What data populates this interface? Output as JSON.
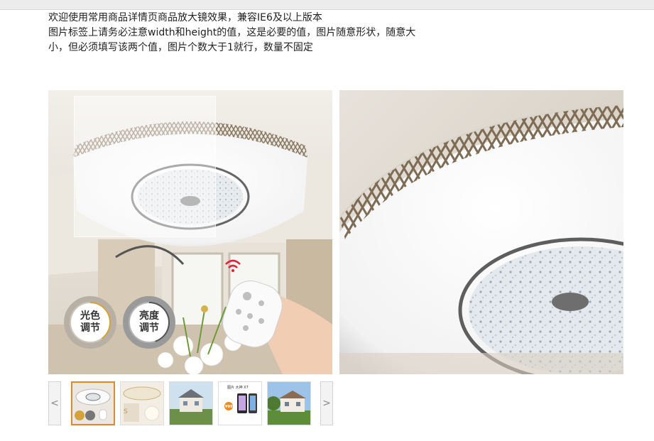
{
  "intro": {
    "line1": "欢迎使用常用商品详情页商品放大镜效果，兼容IE6及以上版本",
    "line2": "图片标签上请务必注意width和height的值，这是必要的值，图片随意形状，随意大",
    "line3": "小，但必须填写该两个值，图片个数大于1就行，数量不固定"
  },
  "badges": {
    "color": {
      "line1": "光色",
      "line2": "调节"
    },
    "brightness": {
      "line1": "亮度",
      "line2": "调节"
    }
  },
  "thumbs": {
    "prev_label": "<",
    "next_label": ">",
    "selected_index": 0,
    "t4_caption": "图片 大神 X7",
    "t4_price": "¥999"
  },
  "colors": {
    "accent": "#e4872b",
    "badge_gold": "#d4a43a"
  }
}
